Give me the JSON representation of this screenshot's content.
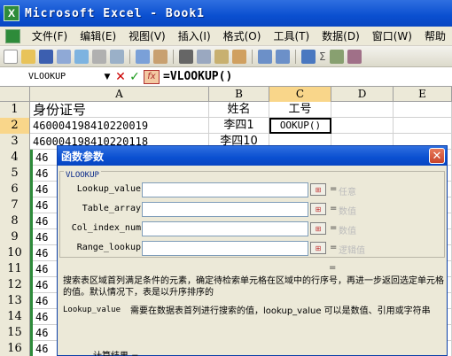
{
  "window": {
    "title": "Microsoft Excel - Book1",
    "app_icon_letter": "X"
  },
  "menu": [
    "文件(F)",
    "编辑(E)",
    "视图(V)",
    "插入(I)",
    "格式(O)",
    "工具(T)",
    "数据(D)",
    "窗口(W)",
    "帮助"
  ],
  "toolbar": {
    "font_label": "Σ"
  },
  "formula_bar": {
    "name_box": "VLOOKUP",
    "cancel": "✕",
    "enter": "✓",
    "fx": "fx",
    "formula": "=VLOOKUP()"
  },
  "columns": [
    "A",
    "B",
    "C",
    "D",
    "E"
  ],
  "rows": [
    {
      "num": "1",
      "a": "身份证号",
      "b": "姓名",
      "c": "工号"
    },
    {
      "num": "2",
      "a": "460004198410220019",
      "b": "李四1",
      "c": "OOKUP()"
    },
    {
      "num": "3",
      "a": "460004198410220118",
      "b": "李四10",
      "c": ""
    },
    {
      "num": "4",
      "a": "46",
      "b": "",
      "c": ""
    },
    {
      "num": "5",
      "a": "46",
      "b": "",
      "c": ""
    },
    {
      "num": "6",
      "a": "46",
      "b": "",
      "c": ""
    },
    {
      "num": "7",
      "a": "46",
      "b": "",
      "c": ""
    },
    {
      "num": "8",
      "a": "46",
      "b": "",
      "c": ""
    },
    {
      "num": "9",
      "a": "46",
      "b": "",
      "c": ""
    },
    {
      "num": "10",
      "a": "46",
      "b": "",
      "c": ""
    },
    {
      "num": "11",
      "a": "46",
      "b": "",
      "c": ""
    },
    {
      "num": "12",
      "a": "46",
      "b": "",
      "c": ""
    },
    {
      "num": "13",
      "a": "46",
      "b": "",
      "c": ""
    },
    {
      "num": "14",
      "a": "46",
      "b": "",
      "c": ""
    },
    {
      "num": "15",
      "a": "46",
      "b": "",
      "c": ""
    },
    {
      "num": "16",
      "a": "46",
      "b": "",
      "c": ""
    }
  ],
  "dialog": {
    "title": "函数参数",
    "close": "✕",
    "function_name": "VLOOKUP",
    "args": [
      {
        "label": "Lookup_value",
        "value": "",
        "ref": "⊞",
        "eq": "=",
        "type": "任意"
      },
      {
        "label": "Table_array",
        "value": "",
        "ref": "⊞",
        "eq": "=",
        "type": "数值"
      },
      {
        "label": "Col_index_num",
        "value": "",
        "ref": "⊞",
        "eq": "=",
        "type": "数值"
      },
      {
        "label": "Range_lookup",
        "value": "",
        "ref": "⊞",
        "eq": "=",
        "type": "逻辑值"
      }
    ],
    "result_eq": "=",
    "description": "搜索表区域首列满足条件的元素，确定待检索单元格在区域中的行序号，再进一步返回选定单元格的值。默认情况下，表是以升序排序的",
    "arg_help_name": "Lookup_value",
    "arg_help_text": "需要在数据表首列进行搜索的值，lookup_value 可以是数值、引用或字符串",
    "calc_result_label": "计算结果 ="
  }
}
